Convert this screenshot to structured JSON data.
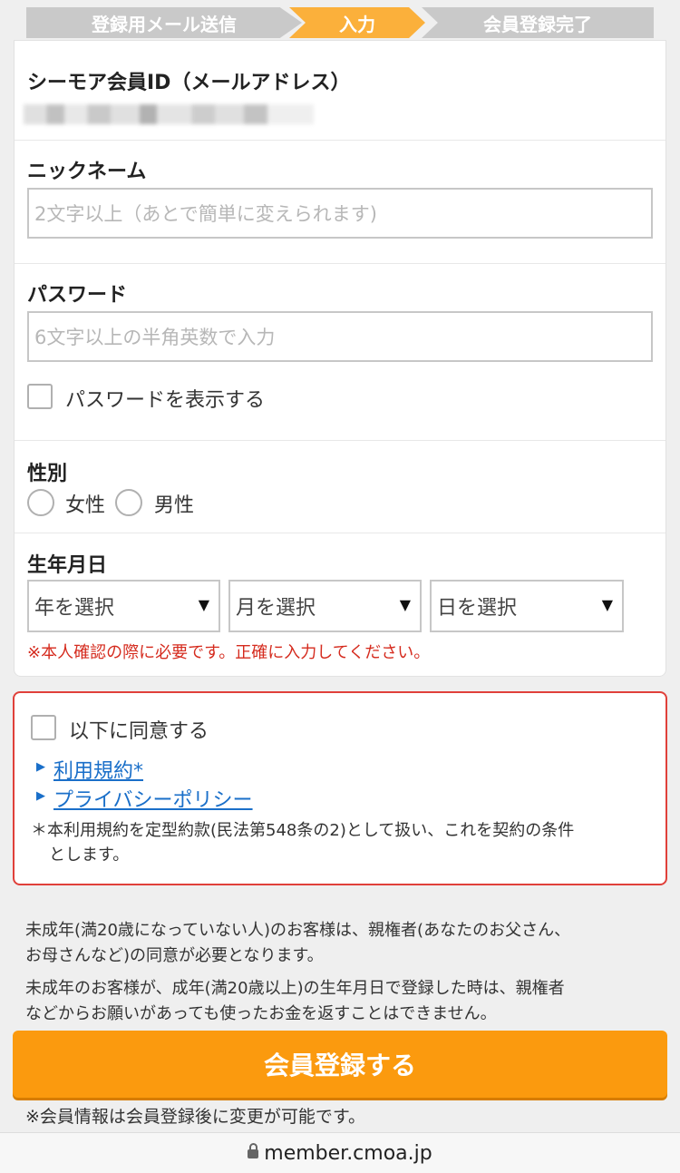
{
  "steps": [
    "登録用メール送信",
    "入力",
    "会員登録完了"
  ],
  "email": {
    "label": "シーモア会員ID（メールアドレス）"
  },
  "nickname": {
    "label": "ニックネーム",
    "placeholder": "2文字以上（あとで簡単に変えられます)"
  },
  "password": {
    "label": "パスワード",
    "placeholder": "6文字以上の半角英数で入力",
    "show_label": "パスワードを表示する"
  },
  "gender": {
    "label": "性別",
    "options": [
      "女性",
      "男性"
    ]
  },
  "birthday": {
    "label": "生年月日",
    "year": "年を選択",
    "month": "月を選択",
    "day": "日を選択",
    "warning": "※本人確認の際に必要です。正確に入力してください。"
  },
  "agree": {
    "label": "以下に同意する",
    "links": [
      "利用規約*",
      "プライバシーポリシー"
    ],
    "note_line1": "＊本利用規約を定型約款(民法第548条の2)として扱い、これを契約の条件",
    "note_line2": "とします。"
  },
  "info": {
    "p1_line1": "未成年(満20歳になっていない人)のお客様は、親権者(あなたのお父さん、",
    "p1_line2": "お母さんなど)の同意が必要となります。",
    "p2_line1": "未成年のお客様が、成年(満20歳以上)の生年月日で登録した時は、親権者",
    "p2_line2": "などからお願いがあっても使ったお金を返すことはできません。"
  },
  "submit_label": "会員登録する",
  "footnote": "※会員情報は会員登録後に変更が可能です。",
  "url": "member.cmoa.jp",
  "colors": {
    "accent": "#fb9a0e",
    "step_active": "#fbb03b",
    "warning": "#d52b1e",
    "link": "#1a6fc9"
  },
  "icons": [
    "triangle-right-icon",
    "lock-icon",
    "dropdown-arrow-icon"
  ]
}
